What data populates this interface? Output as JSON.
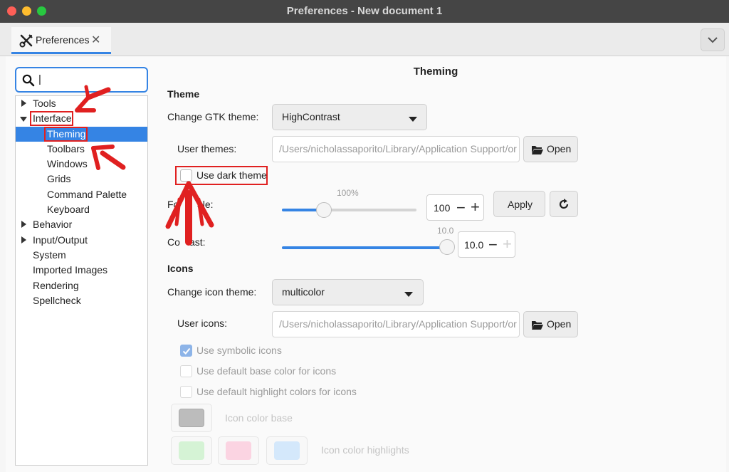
{
  "window": {
    "title": "Preferences - New document 1"
  },
  "tab": {
    "label": "Preferences",
    "icon": "wrench-screwdriver-icon"
  },
  "search": {
    "value": "|"
  },
  "tree": {
    "items": [
      {
        "label": "Tools"
      },
      {
        "label": "Interface"
      },
      {
        "label": "Theming"
      },
      {
        "label": "Toolbars"
      },
      {
        "label": "Windows"
      },
      {
        "label": "Grids"
      },
      {
        "label": "Command Palette"
      },
      {
        "label": "Keyboard"
      },
      {
        "label": "Behavior"
      },
      {
        "label": "Input/Output"
      },
      {
        "label": "System"
      },
      {
        "label": "Imported Images"
      },
      {
        "label": "Rendering"
      },
      {
        "label": "Spellcheck"
      }
    ],
    "selected": "Theming"
  },
  "page": {
    "title": "Theming",
    "theme_heading": "Theme",
    "gtk_theme_label": "Change GTK theme:",
    "gtk_theme_value": "HighContrast",
    "user_themes_label": "User themes:",
    "user_themes_path": "/Users/nicholassaporito/Library/Application Support/or",
    "open_label": "Open",
    "dark_theme_label": "Use dark theme",
    "font_scale_label_visible_start": "Fo",
    "font_scale_label_visible_end": "ale:",
    "font_scale_percent": "100%",
    "font_scale_value": "100",
    "font_scale_fraction": 0.31,
    "apply_label": "Apply",
    "contrast_label_visible_start": "Co",
    "contrast_label_visible_end": "ast:",
    "contrast_top_value": "10.0",
    "contrast_value": "10.0",
    "contrast_fraction": 1.0,
    "icons_heading": "Icons",
    "icon_theme_label": "Change icon theme:",
    "icon_theme_value": "multicolor",
    "user_icons_label": "User icons:",
    "user_icons_path": "/Users/nicholassaporito/Library/Application Support/or",
    "symbolic_label": "Use symbolic icons",
    "symbolic_checked": true,
    "base_color_label": "Use default base color for icons",
    "highlight_colors_label": "Use default highlight colors for icons",
    "icon_color_base_label": "Icon color base",
    "icon_color_highlights_label": "Icon color highlights"
  },
  "colors": {
    "accent": "#3584e4",
    "annotation_red": "#e02020",
    "titlebar": "#454545",
    "close_light": "#fe5f57",
    "minimize_light": "#febc2e",
    "zoom_light": "#28c840",
    "swatch_base": "#bcbcbc",
    "swatch_green": "#d5f3d5",
    "swatch_pink": "#fbd4e2",
    "swatch_blue": "#d4e8fb"
  }
}
